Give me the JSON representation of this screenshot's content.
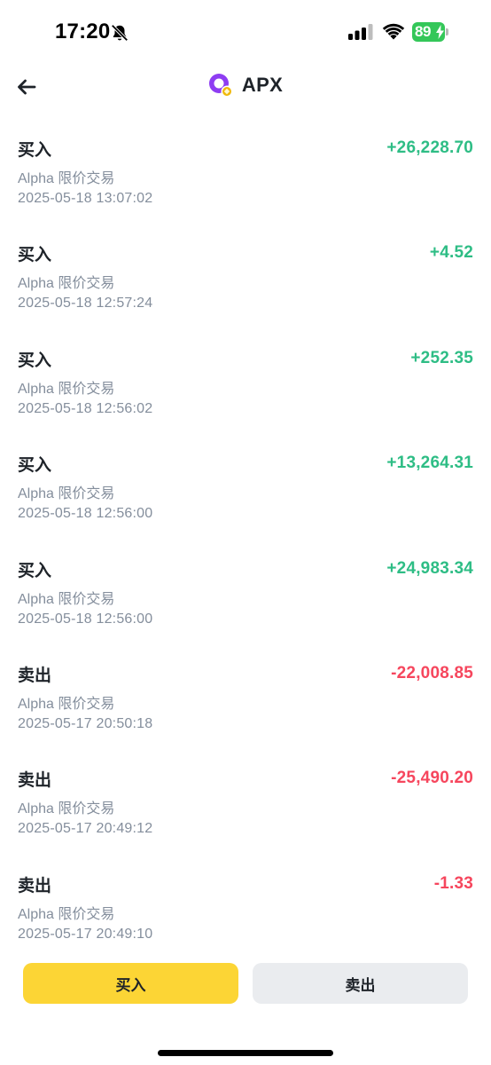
{
  "status_bar": {
    "time": "17:20",
    "battery_level": "89",
    "icons": [
      "bell-slash-icon",
      "cellular-signal-icon",
      "wifi-icon",
      "battery-icon"
    ]
  },
  "header": {
    "title": "APX",
    "back_icon": "arrow-left-icon",
    "logo_icon": "apx-token-logo"
  },
  "transactions": [
    {
      "type": "买入",
      "source": "Alpha 限价交易",
      "time": "2025-05-18 13:07:02",
      "amount": "+26,228.70",
      "direction": "positive"
    },
    {
      "type": "买入",
      "source": "Alpha 限价交易",
      "time": "2025-05-18 12:57:24",
      "amount": "+4.52",
      "direction": "positive"
    },
    {
      "type": "买入",
      "source": "Alpha 限价交易",
      "time": "2025-05-18 12:56:02",
      "amount": "+252.35",
      "direction": "positive"
    },
    {
      "type": "买入",
      "source": "Alpha 限价交易",
      "time": "2025-05-18 12:56:00",
      "amount": "+13,264.31",
      "direction": "positive"
    },
    {
      "type": "买入",
      "source": "Alpha 限价交易",
      "time": "2025-05-18 12:56:00",
      "amount": "+24,983.34",
      "direction": "positive"
    },
    {
      "type": "卖出",
      "source": "Alpha 限价交易",
      "time": "2025-05-17 20:50:18",
      "amount": "-22,008.85",
      "direction": "negative"
    },
    {
      "type": "卖出",
      "source": "Alpha 限价交易",
      "time": "2025-05-17 20:49:12",
      "amount": "-25,490.20",
      "direction": "negative"
    },
    {
      "type": "卖出",
      "source": "Alpha 限价交易",
      "time": "2025-05-17 20:49:10",
      "amount": "-1.33",
      "direction": "negative"
    }
  ],
  "actions": {
    "buy_label": "买入",
    "sell_label": "卖出"
  },
  "colors": {
    "positive": "#2ebd85",
    "negative": "#f6465d",
    "buy_button": "#fcd535",
    "sell_button": "#eaecef",
    "secondary_text": "#848e9c"
  }
}
